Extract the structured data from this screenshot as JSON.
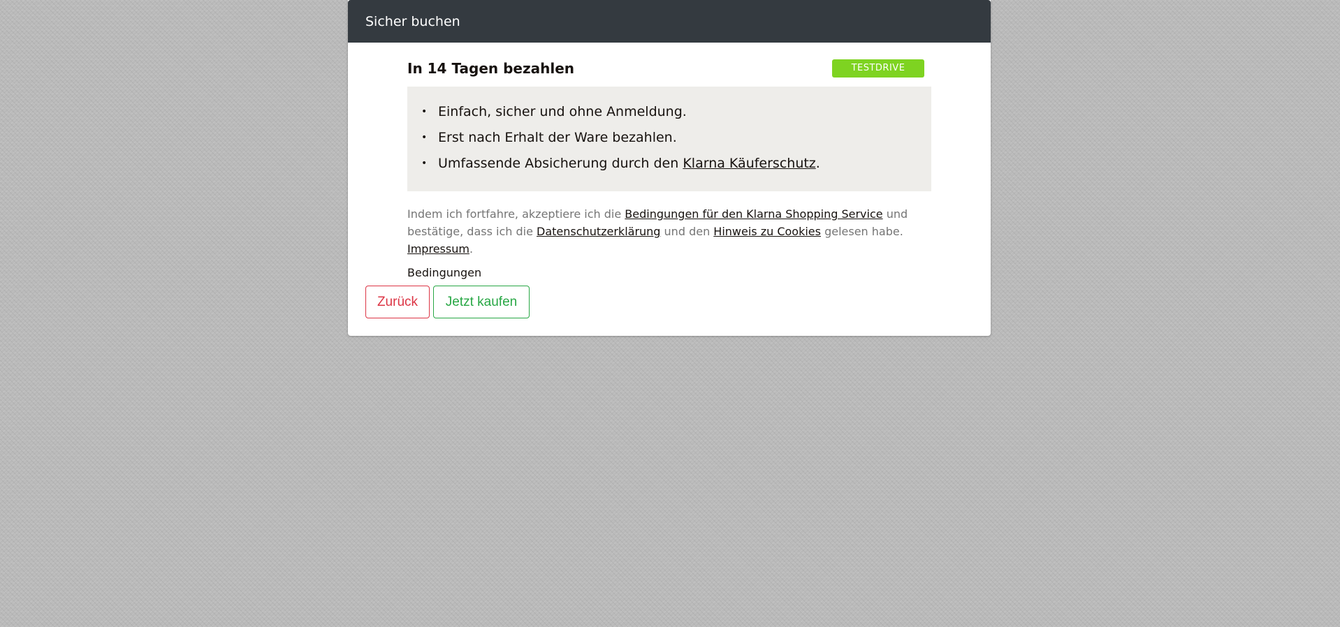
{
  "modal": {
    "title": "Sicher buchen"
  },
  "payment_method": {
    "title": "In 14 Tagen bezahlen",
    "badge": "TESTDRIVE",
    "badge_color": "#7ed321",
    "benefits": [
      "Einfach, sicher und ohne Anmeldung.",
      "Erst nach Erhalt der Ware bezahlen."
    ],
    "benefit_3_prefix": "Umfassende Absicherung durch den ",
    "benefit_3_link": "Klarna Käuferschutz",
    "benefit_3_suffix": "."
  },
  "legal": {
    "text_1": "Indem ich fortfahre, akzeptiere ich die ",
    "link_terms": "Bedingungen für den Klarna Shopping Service",
    "text_2": " und bestätige, dass ich die ",
    "link_privacy": "Datenschutzerklärung",
    "text_3": " und den ",
    "link_cookies": "Hinweis zu Cookies",
    "text_4": " gelesen habe. ",
    "link_imprint": "Impressum",
    "text_5": "."
  },
  "terms_label": "Bedingungen",
  "buttons": {
    "back": "Zurück",
    "buy": "Jetzt kaufen"
  },
  "colors": {
    "header_bg": "#343a40",
    "back_button": "#dc3545",
    "buy_button": "#28a745"
  }
}
